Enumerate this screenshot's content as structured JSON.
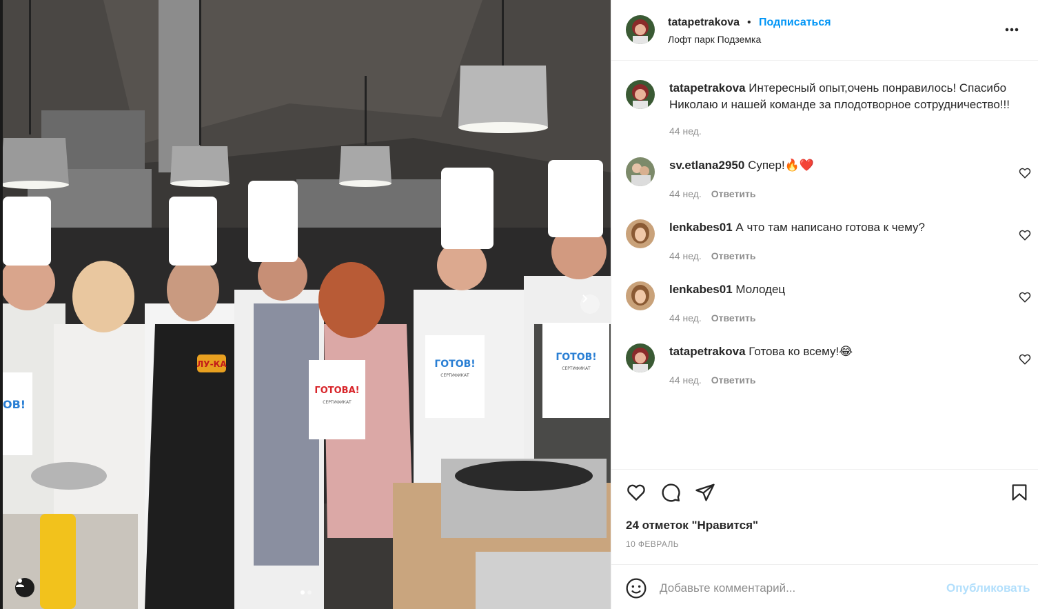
{
  "post": {
    "author": "tatapetrakova",
    "separator": "•",
    "follow_label": "Подписаться",
    "location": "Лофт парк Подземка",
    "more_icon": "more-horizontal-icon",
    "carousel": {
      "slide_count": 2,
      "active_slide": 1
    }
  },
  "photo_signs": {
    "apron_logo": "ЛУ-КА",
    "cert_left": "ГОТОВА!",
    "cert_right_1": "ГОТОВ!",
    "cert_right_2": "ГОТОВ!",
    "cert_sub": "СЕРТИФИКАТ",
    "cert_edge": "ОВ!"
  },
  "caption": {
    "user": "tatapetrakova",
    "text": "Интересный опыт,очень понравилось! Спасибо Николаю и нашей команде за плодотворное сотрудничество!!!",
    "time": "44 нед."
  },
  "comments": [
    {
      "user": "sv.etlana2950",
      "text": "Супер!🔥❤️",
      "time": "44 нед.",
      "reply_label": "Ответить"
    },
    {
      "user": "lenkabes01",
      "text": "А что там написано готова к чему?",
      "time": "44 нед.",
      "reply_label": "Ответить"
    },
    {
      "user": "lenkabes01",
      "text": "Молодец",
      "time": "44 нед.",
      "reply_label": "Ответить"
    },
    {
      "user": "tatapetrakova",
      "text": "Готова ко всему!😂",
      "time": "44 нед.",
      "reply_label": "Ответить"
    }
  ],
  "actions": {
    "like_icon": "heart-icon",
    "comment_icon": "comment-icon",
    "share_icon": "paper-plane-icon",
    "save_icon": "bookmark-icon",
    "likes_text": "24 отметок \"Нравится\"",
    "date": "10 ФЕВРАЛЬ"
  },
  "add_comment": {
    "placeholder": "Добавьте комментарий...",
    "value": "",
    "publish_label": "Опубликовать",
    "emoji_icon": "smiley-icon"
  },
  "colors": {
    "accent": "#0095f6",
    "publish_disabled": "#b2dffc",
    "text": "#262626",
    "muted": "#8e8e8e",
    "divider": "#efefef"
  }
}
